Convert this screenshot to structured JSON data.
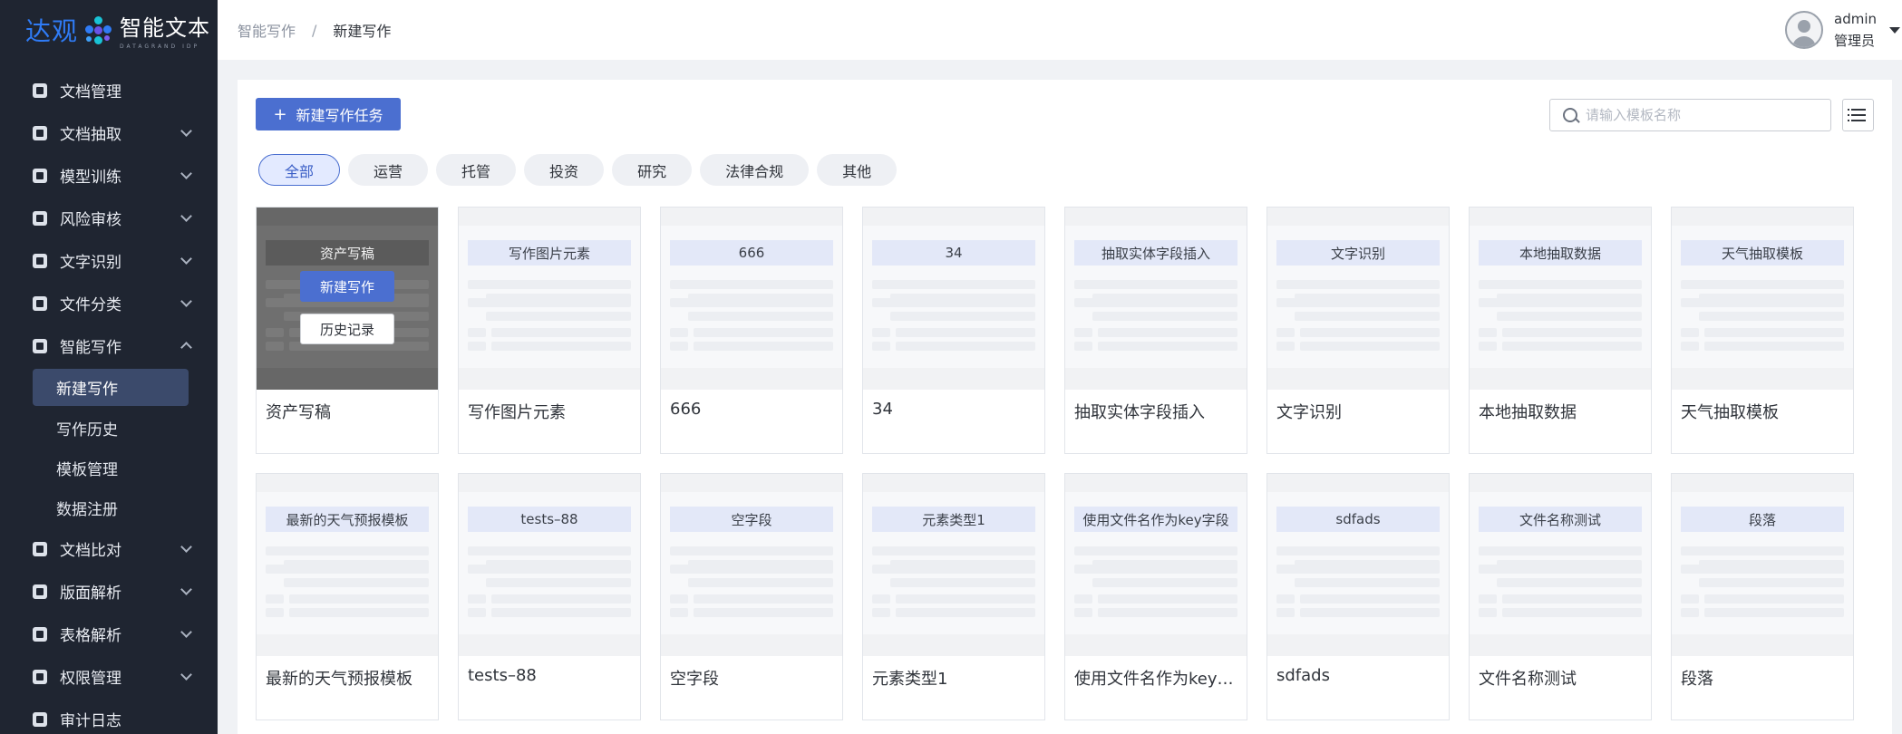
{
  "brand": {
    "name_part1": "达观",
    "name_part2": "智能文本",
    "subtitle": "DATAGRAND IDP"
  },
  "sidebar": {
    "items": [
      {
        "label": "文档管理",
        "icon": "document-icon",
        "has_children": false
      },
      {
        "label": "文档抽取",
        "icon": "extract-icon",
        "has_children": true
      },
      {
        "label": "模型训练",
        "icon": "model-icon",
        "has_children": true
      },
      {
        "label": "风险审核",
        "icon": "risk-icon",
        "has_children": true
      },
      {
        "label": "文字识别",
        "icon": "ocr-icon",
        "has_children": true
      },
      {
        "label": "文件分类",
        "icon": "folder-icon",
        "has_children": true
      },
      {
        "label": "智能写作",
        "icon": "writing-icon",
        "has_children": true,
        "expanded": true,
        "children": [
          {
            "label": "新建写作",
            "active": true
          },
          {
            "label": "写作历史"
          },
          {
            "label": "模板管理"
          },
          {
            "label": "数据注册"
          }
        ]
      },
      {
        "label": "文档比对",
        "icon": "compare-icon",
        "has_children": true
      },
      {
        "label": "版面解析",
        "icon": "layout-icon",
        "has_children": true
      },
      {
        "label": "表格解析",
        "icon": "table-icon",
        "has_children": true
      },
      {
        "label": "权限管理",
        "icon": "shield-icon",
        "has_children": true
      },
      {
        "label": "审计日志",
        "icon": "log-icon",
        "has_children": false
      }
    ]
  },
  "breadcrumb": {
    "parent": "智能写作",
    "separator": "/",
    "current": "新建写作"
  },
  "user": {
    "name": "admin",
    "role": "管理员"
  },
  "toolbar": {
    "new_task_label": "新建写作任务",
    "search_placeholder": "请输入模板名称"
  },
  "filters": [
    "全部",
    "运营",
    "托管",
    "投资",
    "研究",
    "法律合规",
    "其他"
  ],
  "active_filter": "全部",
  "templates": [
    {
      "thumb_title": "资产写稿",
      "name": "资产写稿"
    },
    {
      "thumb_title": "写作图片元素",
      "name": "写作图片元素"
    },
    {
      "thumb_title": "666",
      "name": "666"
    },
    {
      "thumb_title": "34",
      "name": "34"
    },
    {
      "thumb_title": "抽取实体字段插入",
      "name": "抽取实体字段插入"
    },
    {
      "thumb_title": "文字识别",
      "name": "文字识别"
    },
    {
      "thumb_title": "本地抽取数据",
      "name": "本地抽取数据"
    },
    {
      "thumb_title": "天气抽取模板",
      "name": "天气抽取模板"
    },
    {
      "thumb_title": "最新的天气预报模板",
      "name": "最新的天气预报模板"
    },
    {
      "thumb_title": "tests–88",
      "name": "tests–88"
    },
    {
      "thumb_title": "空字段",
      "name": "空字段"
    },
    {
      "thumb_title": "元素类型1",
      "name": "元素类型1"
    },
    {
      "thumb_title": "使用文件名作为key字段",
      "name": "使用文件名作为key…"
    },
    {
      "thumb_title": "sdfads",
      "name": "sdfads"
    },
    {
      "thumb_title": "文件名称测试",
      "name": "文件名称测试"
    },
    {
      "thumb_title": "段落",
      "name": "段落"
    }
  ],
  "hover_card": {
    "new_label": "新建写作",
    "history_label": "历史记录"
  },
  "colors": {
    "sidebar_bg": "#1f2531",
    "accent": "#4b6fd0",
    "active_menu": "#3b4a6b",
    "brand_blue": "#2f7bf5"
  }
}
